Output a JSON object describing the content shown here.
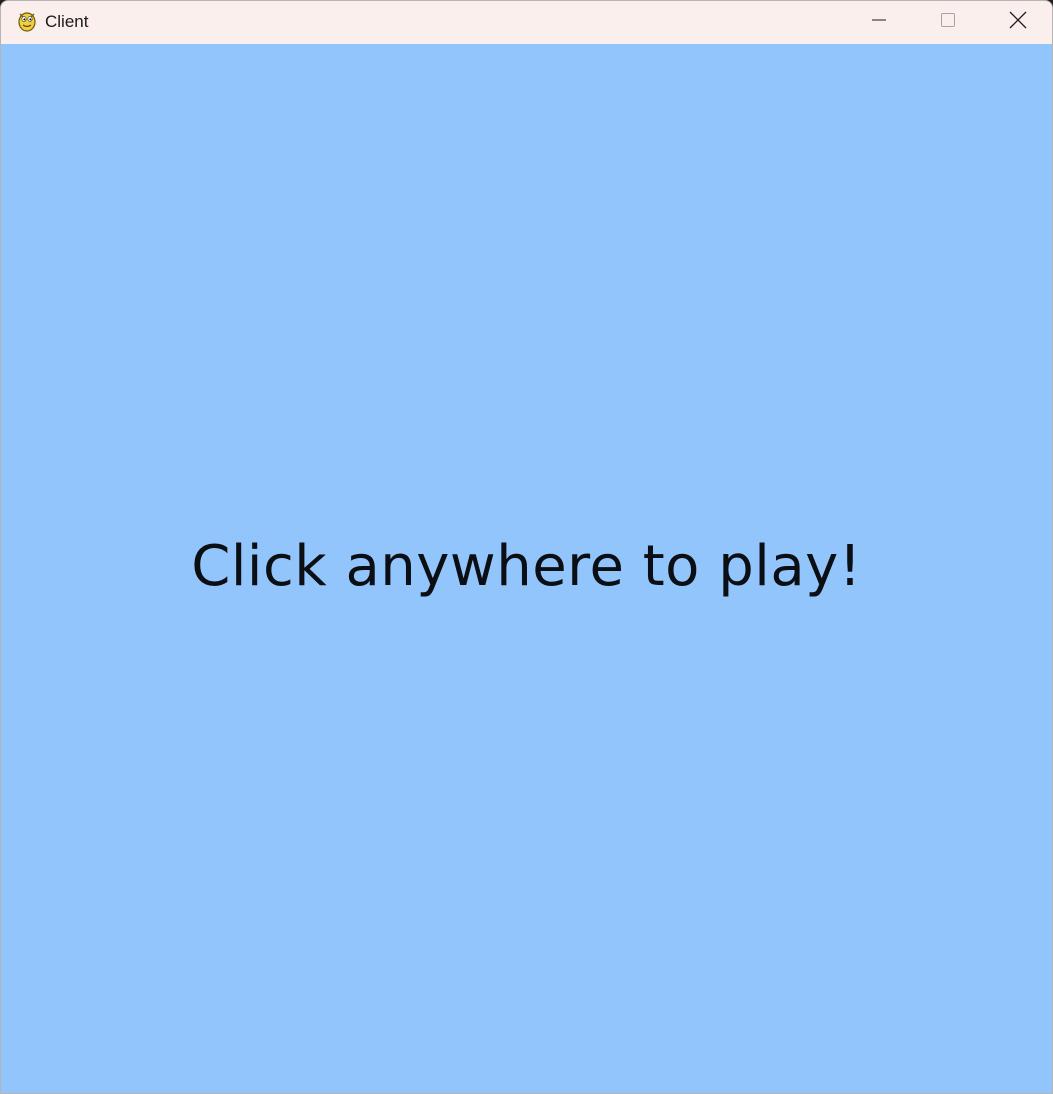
{
  "window": {
    "title": "Client",
    "app_icon": "python-snake-icon",
    "controls": {
      "minimize": "minimize-icon",
      "maximize": "maximize-icon",
      "close": "close-icon"
    }
  },
  "game": {
    "prompt": "Click anywhere to play!",
    "background_color": "#93c5fd",
    "text_color": "#0b0f14"
  }
}
